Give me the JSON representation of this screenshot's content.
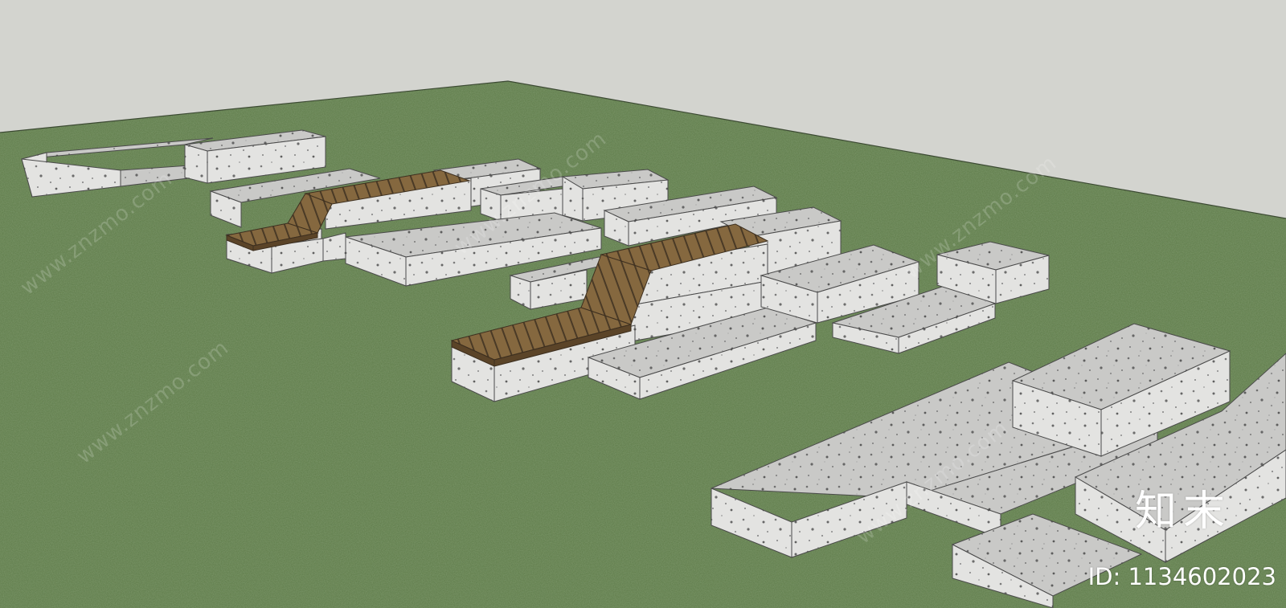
{
  "scene": {
    "description_colors": {
      "sky": "#d3d4cf",
      "grass": "#5d7a48",
      "stone_top": "#bcbcbb",
      "stone_side": "#d9d9d7",
      "wood": "#7a5e3c"
    }
  },
  "watermark": {
    "brand": "知末",
    "id_text": "ID: 1134602023",
    "diagonal_text": "www.znzmo.com"
  }
}
